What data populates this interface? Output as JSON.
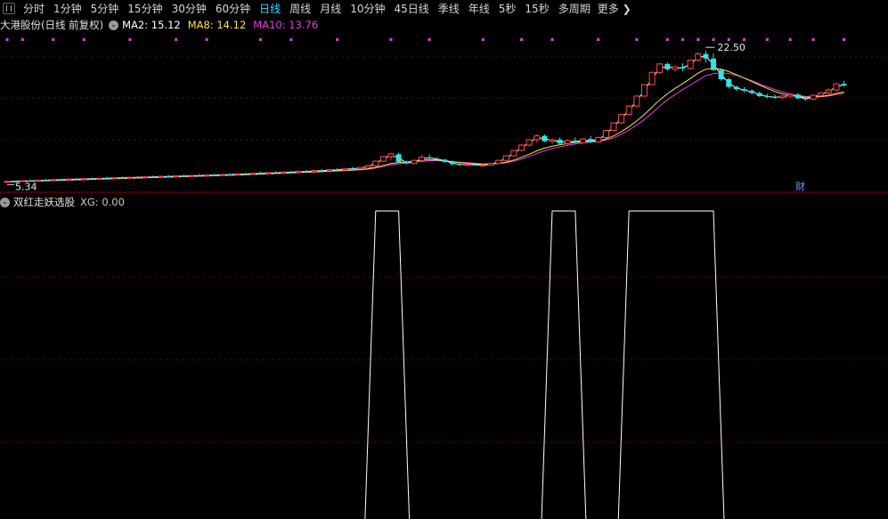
{
  "toolbar": {
    "periods": [
      "分时",
      "1分钟",
      "5分钟",
      "15分钟",
      "30分钟",
      "60分钟",
      "日线",
      "周线",
      "月线",
      "10分钟",
      "45日线",
      "季线",
      "年线",
      "5秒",
      "15秒",
      "多周期"
    ],
    "active_period": "日线",
    "more_label": "更多",
    "more_icon": "chevron-right-icon"
  },
  "main_chart": {
    "stock_title": "大港股份(日线 前复权)",
    "ma_labels": [
      {
        "text": "MA2: 15.12",
        "color": "#ffffff"
      },
      {
        "text": "MA8: 14.12",
        "color": "#ffe04a"
      },
      {
        "text": "MA10: 13.76",
        "color": "#e040e0"
      }
    ],
    "high_label": "22.50",
    "low_label": "5.34",
    "fin_marker": "财",
    "colors": {
      "up": "#ff4a4a",
      "down": "#2ee6e6",
      "ma2": "#ffffff",
      "ma8": "#ffe04a",
      "ma10": "#e040e0",
      "marker": "#e040e0",
      "grid": "#7a0000"
    }
  },
  "indicator": {
    "title": "双红走妖选股",
    "xg_label": "XG: 0.00"
  },
  "chart_data": {
    "type": "candlestick",
    "price_range": [
      4.5,
      24.5
    ],
    "candles": [
      {
        "o": 5.38,
        "h": 5.5,
        "l": 5.28,
        "c": 5.46
      },
      {
        "o": 5.46,
        "h": 5.58,
        "l": 5.4,
        "c": 5.44
      },
      {
        "o": 5.44,
        "h": 5.6,
        "l": 5.38,
        "c": 5.55
      },
      {
        "o": 5.55,
        "h": 5.7,
        "l": 5.48,
        "c": 5.5
      },
      {
        "o": 5.5,
        "h": 5.66,
        "l": 5.44,
        "c": 5.62
      },
      {
        "o": 5.62,
        "h": 5.8,
        "l": 5.55,
        "c": 5.6
      },
      {
        "o": 5.6,
        "h": 5.74,
        "l": 5.52,
        "c": 5.7
      },
      {
        "o": 5.7,
        "h": 5.84,
        "l": 5.62,
        "c": 5.66
      },
      {
        "o": 5.66,
        "h": 5.8,
        "l": 5.58,
        "c": 5.76
      },
      {
        "o": 5.76,
        "h": 5.92,
        "l": 5.68,
        "c": 5.72
      },
      {
        "o": 5.72,
        "h": 5.86,
        "l": 5.64,
        "c": 5.82
      },
      {
        "o": 5.82,
        "h": 5.98,
        "l": 5.74,
        "c": 5.78
      },
      {
        "o": 5.78,
        "h": 5.92,
        "l": 5.7,
        "c": 5.88
      },
      {
        "o": 5.88,
        "h": 6.06,
        "l": 5.8,
        "c": 5.84
      },
      {
        "o": 5.84,
        "h": 5.98,
        "l": 5.76,
        "c": 5.94
      },
      {
        "o": 5.94,
        "h": 6.1,
        "l": 5.86,
        "c": 5.9
      },
      {
        "o": 5.9,
        "h": 6.04,
        "l": 5.82,
        "c": 6.0
      },
      {
        "o": 6.0,
        "h": 6.16,
        "l": 5.92,
        "c": 5.96
      },
      {
        "o": 5.96,
        "h": 6.1,
        "l": 5.88,
        "c": 6.06
      },
      {
        "o": 6.06,
        "h": 6.22,
        "l": 5.98,
        "c": 6.02
      },
      {
        "o": 6.02,
        "h": 6.16,
        "l": 5.94,
        "c": 6.12
      },
      {
        "o": 6.12,
        "h": 6.3,
        "l": 6.04,
        "c": 6.08
      },
      {
        "o": 6.08,
        "h": 6.22,
        "l": 6.0,
        "c": 6.18
      },
      {
        "o": 6.18,
        "h": 6.34,
        "l": 6.1,
        "c": 6.14
      },
      {
        "o": 6.14,
        "h": 6.28,
        "l": 6.06,
        "c": 6.24
      },
      {
        "o": 6.24,
        "h": 6.4,
        "l": 6.16,
        "c": 6.2
      },
      {
        "o": 6.2,
        "h": 6.36,
        "l": 6.12,
        "c": 6.3
      },
      {
        "o": 6.3,
        "h": 6.46,
        "l": 6.22,
        "c": 6.26
      },
      {
        "o": 6.26,
        "h": 6.42,
        "l": 6.18,
        "c": 6.36
      },
      {
        "o": 6.36,
        "h": 6.52,
        "l": 6.28,
        "c": 6.32
      },
      {
        "o": 6.32,
        "h": 6.48,
        "l": 6.24,
        "c": 6.44
      },
      {
        "o": 6.44,
        "h": 6.6,
        "l": 6.36,
        "c": 6.4
      },
      {
        "o": 6.4,
        "h": 6.56,
        "l": 6.32,
        "c": 6.52
      },
      {
        "o": 6.52,
        "h": 6.7,
        "l": 6.44,
        "c": 6.48
      },
      {
        "o": 6.48,
        "h": 6.64,
        "l": 6.4,
        "c": 6.6
      },
      {
        "o": 6.6,
        "h": 6.78,
        "l": 6.52,
        "c": 6.56
      },
      {
        "o": 6.56,
        "h": 6.72,
        "l": 6.48,
        "c": 6.68
      },
      {
        "o": 6.68,
        "h": 6.86,
        "l": 6.6,
        "c": 6.64
      },
      {
        "o": 6.64,
        "h": 6.82,
        "l": 6.56,
        "c": 6.78
      },
      {
        "o": 6.78,
        "h": 6.96,
        "l": 6.7,
        "c": 6.74
      },
      {
        "o": 6.74,
        "h": 6.92,
        "l": 6.66,
        "c": 6.88
      },
      {
        "o": 6.88,
        "h": 7.06,
        "l": 6.8,
        "c": 6.84
      },
      {
        "o": 6.84,
        "h": 7.02,
        "l": 6.76,
        "c": 7.0
      },
      {
        "o": 7.0,
        "h": 7.2,
        "l": 6.92,
        "c": 6.96
      },
      {
        "o": 6.96,
        "h": 7.16,
        "l": 6.88,
        "c": 7.14
      },
      {
        "o": 7.14,
        "h": 7.36,
        "l": 7.06,
        "c": 7.1
      },
      {
        "o": 7.1,
        "h": 7.3,
        "l": 7.02,
        "c": 7.28
      },
      {
        "o": 7.28,
        "h": 7.6,
        "l": 7.2,
        "c": 7.52
      },
      {
        "o": 7.52,
        "h": 8.2,
        "l": 7.44,
        "c": 8.1
      },
      {
        "o": 8.1,
        "h": 8.8,
        "l": 8.0,
        "c": 8.7
      },
      {
        "o": 8.7,
        "h": 9.2,
        "l": 8.3,
        "c": 9.05
      },
      {
        "o": 9.0,
        "h": 9.2,
        "l": 7.9,
        "c": 8.0
      },
      {
        "o": 8.0,
        "h": 8.2,
        "l": 7.7,
        "c": 7.8
      },
      {
        "o": 7.8,
        "h": 8.3,
        "l": 7.7,
        "c": 8.2
      },
      {
        "o": 8.2,
        "h": 8.9,
        "l": 8.1,
        "c": 8.6
      },
      {
        "o": 8.6,
        "h": 9.0,
        "l": 8.4,
        "c": 8.5
      },
      {
        "o": 8.4,
        "h": 8.6,
        "l": 8.1,
        "c": 8.3
      },
      {
        "o": 8.3,
        "h": 8.4,
        "l": 7.9,
        "c": 8.0
      },
      {
        "o": 8.0,
        "h": 8.2,
        "l": 7.6,
        "c": 7.7
      },
      {
        "o": 7.7,
        "h": 7.9,
        "l": 7.5,
        "c": 7.6
      },
      {
        "o": 7.6,
        "h": 7.8,
        "l": 7.4,
        "c": 7.7
      },
      {
        "o": 7.7,
        "h": 7.9,
        "l": 7.5,
        "c": 7.55
      },
      {
        "o": 7.55,
        "h": 7.75,
        "l": 7.4,
        "c": 7.6
      },
      {
        "o": 7.6,
        "h": 7.9,
        "l": 7.5,
        "c": 7.8
      },
      {
        "o": 7.8,
        "h": 8.3,
        "l": 7.7,
        "c": 8.2
      },
      {
        "o": 8.2,
        "h": 8.9,
        "l": 8.1,
        "c": 8.8
      },
      {
        "o": 8.8,
        "h": 9.6,
        "l": 8.7,
        "c": 9.5
      },
      {
        "o": 9.5,
        "h": 10.3,
        "l": 9.4,
        "c": 10.2
      },
      {
        "o": 10.2,
        "h": 11.0,
        "l": 10.0,
        "c": 10.9
      },
      {
        "o": 10.9,
        "h": 11.6,
        "l": 10.5,
        "c": 11.4
      },
      {
        "o": 11.4,
        "h": 11.6,
        "l": 10.6,
        "c": 10.7
      },
      {
        "o": 10.7,
        "h": 11.1,
        "l": 10.4,
        "c": 10.9
      },
      {
        "o": 10.9,
        "h": 11.2,
        "l": 10.3,
        "c": 10.4
      },
      {
        "o": 10.4,
        "h": 10.9,
        "l": 10.2,
        "c": 10.8
      },
      {
        "o": 10.8,
        "h": 11.2,
        "l": 10.4,
        "c": 10.5
      },
      {
        "o": 10.5,
        "h": 11.1,
        "l": 10.4,
        "c": 11.0
      },
      {
        "o": 11.0,
        "h": 11.4,
        "l": 10.5,
        "c": 10.6
      },
      {
        "o": 10.6,
        "h": 11.3,
        "l": 10.5,
        "c": 11.2
      },
      {
        "o": 11.2,
        "h": 12.2,
        "l": 11.1,
        "c": 12.1
      },
      {
        "o": 12.1,
        "h": 13.2,
        "l": 12.0,
        "c": 13.1
      },
      {
        "o": 13.1,
        "h": 14.3,
        "l": 13.0,
        "c": 14.2
      },
      {
        "o": 14.2,
        "h": 15.4,
        "l": 14.1,
        "c": 15.3
      },
      {
        "o": 15.3,
        "h": 16.7,
        "l": 15.2,
        "c": 16.6
      },
      {
        "o": 16.6,
        "h": 18.2,
        "l": 16.5,
        "c": 18.1
      },
      {
        "o": 18.1,
        "h": 19.8,
        "l": 18.0,
        "c": 19.7
      },
      {
        "o": 19.7,
        "h": 20.9,
        "l": 19.5,
        "c": 20.8
      },
      {
        "o": 20.8,
        "h": 21.0,
        "l": 19.9,
        "c": 20.1
      },
      {
        "o": 20.1,
        "h": 20.6,
        "l": 19.8,
        "c": 20.4
      },
      {
        "o": 20.4,
        "h": 20.9,
        "l": 19.9,
        "c": 20.2
      },
      {
        "o": 20.2,
        "h": 21.4,
        "l": 20.1,
        "c": 21.3
      },
      {
        "o": 21.3,
        "h": 22.3,
        "l": 21.1,
        "c": 22.1
      },
      {
        "o": 22.1,
        "h": 22.5,
        "l": 21.0,
        "c": 21.5
      },
      {
        "o": 21.5,
        "h": 22.2,
        "l": 19.9,
        "c": 20.0
      },
      {
        "o": 20.0,
        "h": 20.2,
        "l": 18.6,
        "c": 18.8
      },
      {
        "o": 18.8,
        "h": 19.0,
        "l": 17.6,
        "c": 17.8
      },
      {
        "o": 17.8,
        "h": 18.0,
        "l": 17.3,
        "c": 17.5
      },
      {
        "o": 17.5,
        "h": 17.8,
        "l": 17.1,
        "c": 17.3
      },
      {
        "o": 17.3,
        "h": 17.5,
        "l": 16.8,
        "c": 17.0
      },
      {
        "o": 17.0,
        "h": 17.2,
        "l": 16.5,
        "c": 16.6
      },
      {
        "o": 16.6,
        "h": 16.9,
        "l": 16.3,
        "c": 16.5
      },
      {
        "o": 16.5,
        "h": 16.8,
        "l": 16.2,
        "c": 16.4
      },
      {
        "o": 16.4,
        "h": 16.7,
        "l": 16.2,
        "c": 16.6
      },
      {
        "o": 16.6,
        "h": 16.9,
        "l": 16.4,
        "c": 16.8
      },
      {
        "o": 16.8,
        "h": 17.0,
        "l": 16.2,
        "c": 16.3
      },
      {
        "o": 16.3,
        "h": 16.5,
        "l": 16.0,
        "c": 16.2
      },
      {
        "o": 16.2,
        "h": 16.8,
        "l": 16.1,
        "c": 16.7
      },
      {
        "o": 16.7,
        "h": 17.1,
        "l": 16.5,
        "c": 17.0
      },
      {
        "o": 17.0,
        "h": 17.6,
        "l": 16.8,
        "c": 17.4
      },
      {
        "o": 17.4,
        "h": 18.3,
        "l": 17.2,
        "c": 18.2
      },
      {
        "o": 18.2,
        "h": 18.6,
        "l": 17.8,
        "c": 18.0
      }
    ],
    "ma2": [
      5.42,
      5.45,
      5.5,
      5.52,
      5.56,
      5.61,
      5.65,
      5.68,
      5.71,
      5.74,
      5.77,
      5.8,
      5.83,
      5.86,
      5.89,
      5.92,
      5.95,
      5.98,
      6.01,
      6.04,
      6.07,
      6.1,
      6.13,
      6.16,
      6.19,
      6.22,
      6.25,
      6.28,
      6.31,
      6.34,
      6.38,
      6.42,
      6.46,
      6.5,
      6.54,
      6.58,
      6.62,
      6.66,
      6.71,
      6.76,
      6.81,
      6.86,
      6.92,
      6.98,
      7.05,
      7.12,
      7.19,
      7.4,
      7.81,
      8.4,
      8.88,
      8.52,
      7.9,
      8.0,
      8.4,
      8.55,
      8.4,
      8.15,
      7.85,
      7.65,
      7.65,
      7.62,
      7.58,
      7.7,
      8.0,
      8.5,
      9.15,
      9.85,
      10.55,
      11.15,
      11.05,
      10.8,
      10.65,
      10.6,
      10.65,
      10.75,
      10.8,
      10.9,
      11.65,
      12.6,
      13.65,
      14.75,
      15.95,
      17.35,
      18.9,
      20.25,
      20.45,
      20.25,
      20.3,
      20.75,
      21.7,
      21.8,
      20.75,
      19.4,
      18.3,
      17.65,
      17.4,
      17.15,
      16.8,
      16.55,
      16.45,
      16.5,
      16.7,
      16.55,
      16.25,
      16.45,
      16.85,
      17.2,
      17.8,
      18.1
    ],
    "ma8": [
      5.4,
      5.43,
      5.46,
      5.49,
      5.52,
      5.55,
      5.58,
      5.61,
      5.64,
      5.67,
      5.7,
      5.73,
      5.76,
      5.79,
      5.82,
      5.85,
      5.88,
      5.91,
      5.94,
      5.97,
      6.0,
      6.03,
      6.06,
      6.09,
      6.12,
      6.15,
      6.18,
      6.21,
      6.24,
      6.27,
      6.3,
      6.34,
      6.38,
      6.42,
      6.46,
      6.5,
      6.54,
      6.58,
      6.62,
      6.66,
      6.7,
      6.74,
      6.79,
      6.84,
      6.89,
      6.94,
      7.0,
      7.1,
      7.3,
      7.55,
      7.8,
      7.92,
      7.98,
      8.1,
      8.2,
      8.3,
      8.25,
      8.15,
      8.0,
      7.9,
      7.82,
      7.75,
      7.7,
      7.72,
      7.8,
      7.98,
      8.25,
      8.6,
      9.0,
      9.45,
      9.8,
      10.05,
      10.25,
      10.4,
      10.55,
      10.65,
      10.7,
      10.75,
      11.0,
      11.4,
      11.95,
      12.6,
      13.35,
      14.2,
      15.15,
      16.1,
      16.9,
      17.6,
      18.25,
      18.9,
      19.6,
      20.1,
      20.25,
      20.1,
      19.8,
      19.4,
      18.95,
      18.5,
      18.05,
      17.6,
      17.2,
      16.9,
      16.7,
      16.55,
      16.45,
      16.45,
      16.55,
      16.7,
      16.95,
      17.15
    ],
    "ma10": [
      5.38,
      5.41,
      5.44,
      5.47,
      5.5,
      5.53,
      5.56,
      5.59,
      5.62,
      5.65,
      5.68,
      5.71,
      5.74,
      5.77,
      5.8,
      5.83,
      5.86,
      5.89,
      5.92,
      5.95,
      5.98,
      6.01,
      6.04,
      6.07,
      6.1,
      6.13,
      6.16,
      6.19,
      6.22,
      6.25,
      6.28,
      6.32,
      6.36,
      6.4,
      6.44,
      6.48,
      6.52,
      6.56,
      6.6,
      6.64,
      6.68,
      6.72,
      6.77,
      6.82,
      6.87,
      6.92,
      6.97,
      7.05,
      7.2,
      7.4,
      7.62,
      7.76,
      7.86,
      7.96,
      8.06,
      8.16,
      8.18,
      8.14,
      8.05,
      7.96,
      7.88,
      7.81,
      7.75,
      7.74,
      7.78,
      7.9,
      8.1,
      8.38,
      8.72,
      9.1,
      9.45,
      9.74,
      9.98,
      10.18,
      10.35,
      10.48,
      10.58,
      10.66,
      10.85,
      11.15,
      11.6,
      12.15,
      12.8,
      13.55,
      14.4,
      15.3,
      16.1,
      16.8,
      17.45,
      18.05,
      18.7,
      19.25,
      19.55,
      19.65,
      19.55,
      19.3,
      18.95,
      18.6,
      18.2,
      17.8,
      17.45,
      17.15,
      16.9,
      16.7,
      16.55,
      16.5,
      16.52,
      16.6,
      16.8,
      16.98
    ],
    "xg_segments": [
      {
        "from_index": 48,
        "to_index": 51
      },
      {
        "from_index": 71,
        "to_index": 74
      },
      {
        "from_index": 81,
        "to_index": 92
      }
    ],
    "xg_range": [
      0,
      1
    ],
    "marker_indices": [
      0,
      2,
      6,
      10,
      16,
      22,
      26,
      33,
      37,
      43,
      50,
      55,
      62,
      67,
      71,
      77,
      82,
      86,
      88,
      90,
      92,
      94,
      96,
      99,
      102,
      105,
      109
    ]
  }
}
